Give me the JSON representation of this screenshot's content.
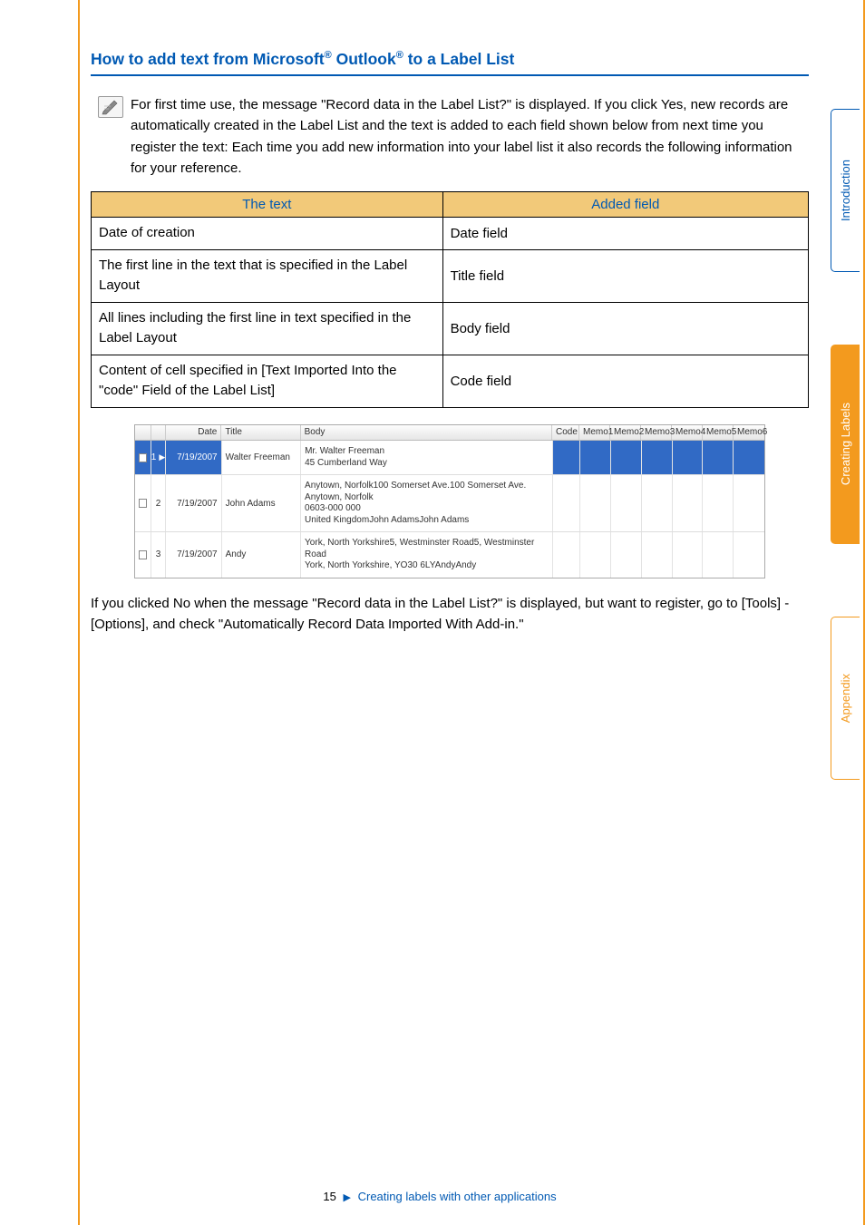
{
  "heading": {
    "pre": "How to add text from Microsoft",
    "reg1": "®",
    "mid": " Outlook",
    "reg2": "®",
    "post": " to a Label List"
  },
  "note": "For first time use, the message \"Record data in the Label List?\" is displayed. If you click Yes, new records are automatically created in the Label List and the text is added to each field shown below from next time you register the text: Each time you add new information into your label list it also records the following information for your reference.",
  "table": {
    "headers": {
      "c1": "The text",
      "c2": "Added field"
    },
    "rows": [
      {
        "c1": "Date of creation",
        "c2": "Date field"
      },
      {
        "c1": "The first line in the text that is specified in the Label Layout",
        "c2": "Title field"
      },
      {
        "c1": "All lines including the first line in text specified in the Label Layout",
        "c2": "Body field"
      },
      {
        "c1": "Content of cell specified in [Text Imported Into the \"code\" Field of the Label List]",
        "c2": "Code field"
      }
    ]
  },
  "screenshot": {
    "headers": {
      "date": "Date",
      "title": "Title",
      "body": "Body",
      "code": "Code",
      "memo1": "Memo1",
      "memo2": "Memo2",
      "memo3": "Memo3",
      "memo4": "Memo4",
      "memo5": "Memo5",
      "memo6": "Memo6"
    },
    "rows": [
      {
        "idx": "1",
        "date": "7/19/2007",
        "title": "Walter Freeman",
        "body": "Mr. Walter Freeman\n45 Cumberland Way",
        "selected": true
      },
      {
        "idx": "2",
        "date": "7/19/2007",
        "title": "John Adams",
        "body": "Anytown, Norfolk100 Somerset Ave.100 Somerset Ave.\nAnytown, Norfolk\n0603-000 000\nUnited KingdomJohn AdamsJohn Adams",
        "selected": false
      },
      {
        "idx": "3",
        "date": "7/19/2007",
        "title": "Andy",
        "body": "York, North Yorkshire5, Westminster Road5, Westminster Road\nYork, North Yorkshire, YO30 6LYAndyAndy",
        "selected": false
      }
    ]
  },
  "followup": "If you clicked No when the message \"Record data in the Label List?\" is displayed, but want to register, go to [Tools] - [Options], and check \"Automatically Record Data Imported With Add-in.\"",
  "sidetabs": {
    "intro": "Introduction",
    "creating": "Creating Labels",
    "appendix": "Appendix"
  },
  "footer": {
    "page": "15",
    "arrow": "▶",
    "link": "Creating labels with other applications"
  }
}
